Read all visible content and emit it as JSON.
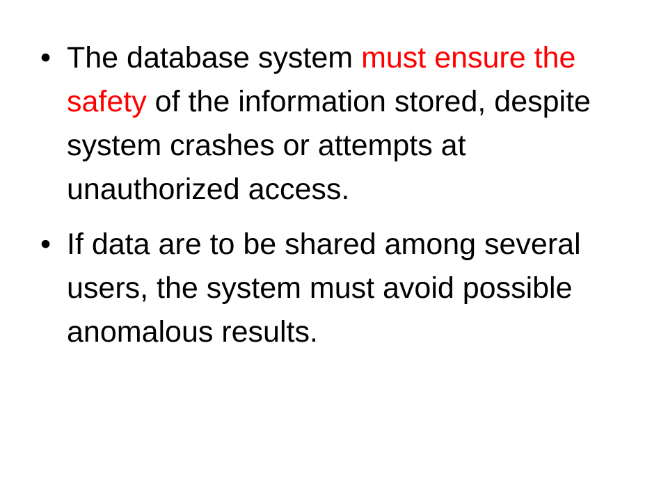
{
  "slide": {
    "accent_color": "#ff0000",
    "bullet_glyph": "•",
    "bullets": [
      {
        "segments": [
          {
            "text": "The database system ",
            "color": "#000000"
          },
          {
            "text": "must ensure the safety",
            "color": "#ff0000"
          },
          {
            "text": " of the information stored, despite system crashes or attempts at unauthorized access.",
            "color": "#000000"
          }
        ]
      },
      {
        "segments": [
          {
            "text": "If data are to be shared among several users, the system must avoid possible anomalous results.",
            "color": "#000000"
          }
        ]
      }
    ]
  }
}
